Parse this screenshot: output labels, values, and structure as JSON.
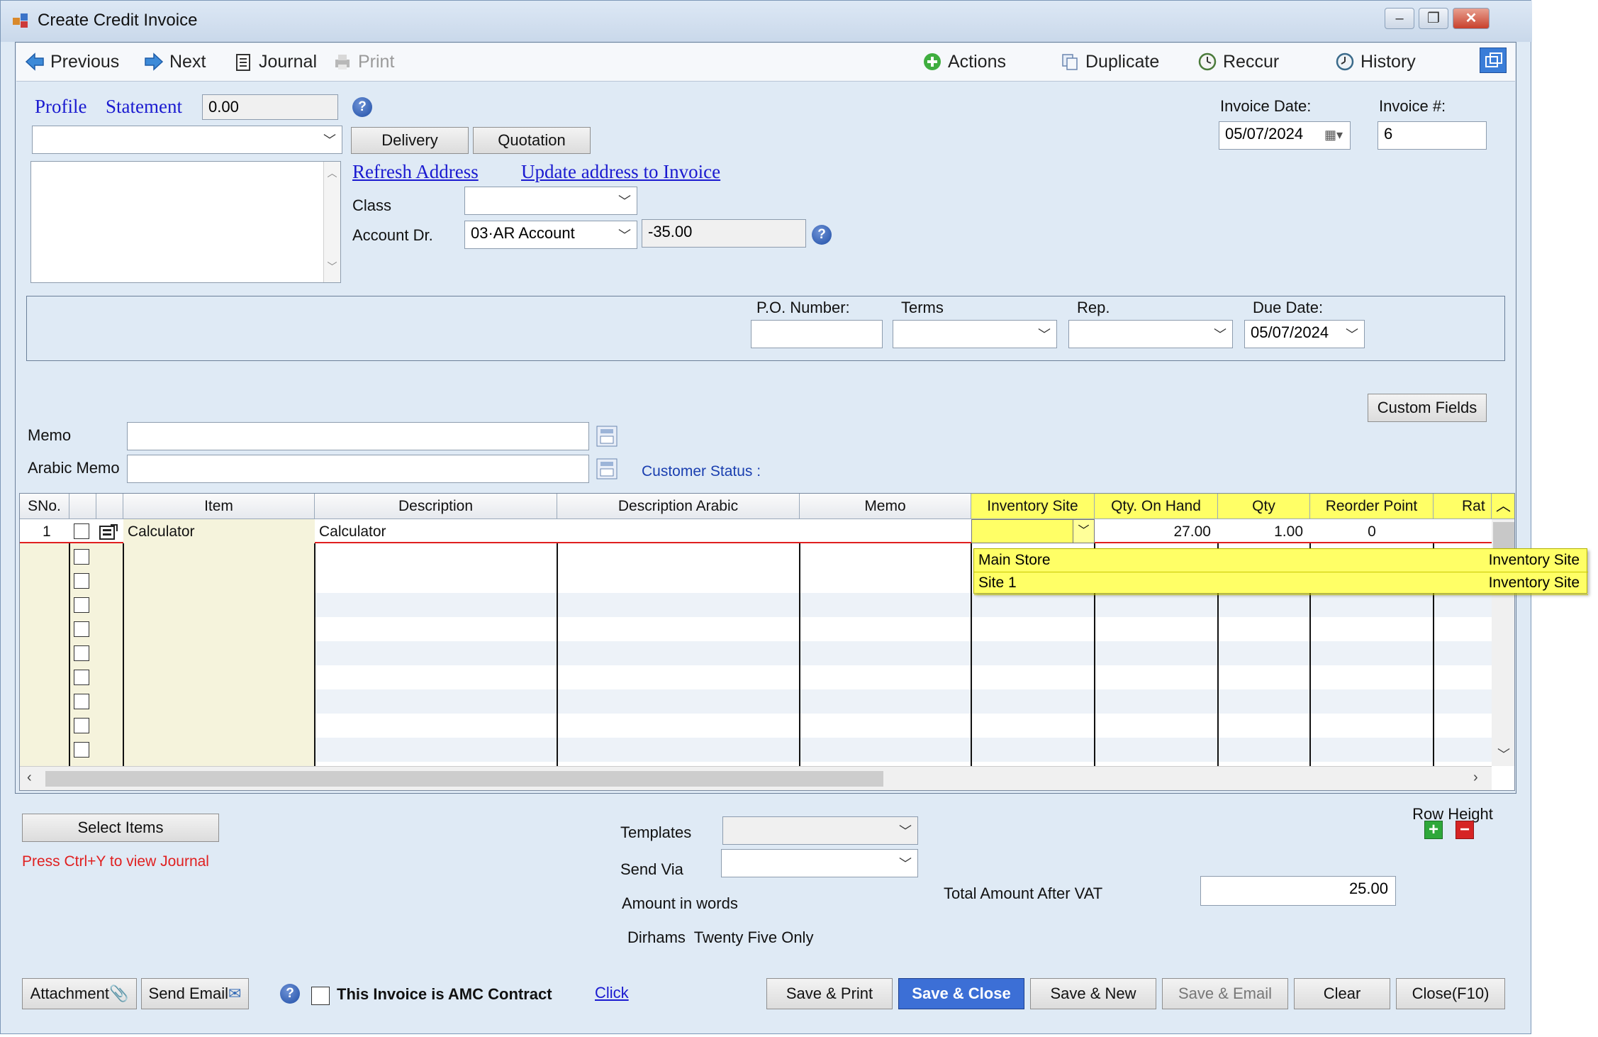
{
  "window": {
    "title": "Create Credit Invoice",
    "controls": [
      "minimize",
      "maximize",
      "close"
    ]
  },
  "toolbar": {
    "previous": "Previous",
    "next": "Next",
    "journal": "Journal",
    "print": "Print",
    "actions": "Actions",
    "duplicate": "Duplicate",
    "reccur": "Reccur",
    "history": "History"
  },
  "customer": {
    "profile_link": "Profile",
    "statement_link": "Statement",
    "balance": "0.00",
    "customer_select": "",
    "address": "",
    "delivery_button": "Delivery",
    "quotation_button": "Quotation",
    "refresh_address": "Refresh Address",
    "update_address": "Update address to Invoice",
    "class_label": "Class",
    "class_value": "",
    "account_label": "Account Dr.",
    "account_value": "03·AR Account",
    "account_balance": "-35.00"
  },
  "invoice": {
    "date_label": "Invoice Date:",
    "date_value": "05/07/2024",
    "number_label": "Invoice #:",
    "number_value": "6"
  },
  "shipping": {
    "po_label": "P.O. Number:",
    "po_value": "",
    "terms_label": "Terms",
    "terms_value": "",
    "rep_label": "Rep.",
    "rep_value": "",
    "due_label": "Due Date:",
    "due_value": "05/07/2024"
  },
  "memo": {
    "custom_fields_button": "Custom Fields",
    "memo_label": "Memo",
    "memo_value": "",
    "arabic_memo_label": "Arabic Memo",
    "arabic_memo_value": "",
    "customer_status": "Customer Status :"
  },
  "grid": {
    "columns": [
      "SNo.",
      "",
      "",
      "Item",
      "Description",
      "Description Arabic",
      "Memo",
      "Inventory Site",
      "Qty. On Hand",
      "Qty",
      "Reorder Point",
      "Rat"
    ],
    "rows": [
      {
        "sno": "1",
        "item": "Calculator",
        "description": "Calculator",
        "description_arabic": "",
        "memo": "",
        "inventory_site": "",
        "qty_on_hand": "27.00",
        "qty": "1.00",
        "reorder_point": "0"
      }
    ],
    "dropdown": [
      {
        "name": "Main Store",
        "type": "Inventory Site"
      },
      {
        "name": "Site 1",
        "type": "Inventory Site"
      }
    ]
  },
  "footer": {
    "select_items": "Select Items",
    "journal_hint": "Press Ctrl+Y to view Journal",
    "templates_label": "Templates",
    "templates_value": "",
    "send_via_label": "Send Via",
    "send_via_value": "",
    "amount_words_label": "Amount in words",
    "amount_words_value": "Dirhams  Twenty Five Only",
    "total_label": "Total Amount After VAT",
    "total_value": "25.00",
    "row_height_label": "Row Height",
    "attachment": "Attachment",
    "send_email": "Send Email",
    "amc_label": "This Invoice is AMC Contract",
    "click_link": "Click",
    "save_print": "Save & Print",
    "save_close": "Save & Close",
    "save_new": "Save & New",
    "save_email": "Save & Email",
    "clear": "Clear",
    "close": "Close(F10)"
  },
  "colors": {
    "window_bg": "#dfeaf5",
    "highlight_yellow": "#ffff66",
    "primary_button": "#3c6fd6",
    "link_blue": "#1a1ad0",
    "hint_red": "#e02020",
    "row_red_line": "#e02020"
  }
}
